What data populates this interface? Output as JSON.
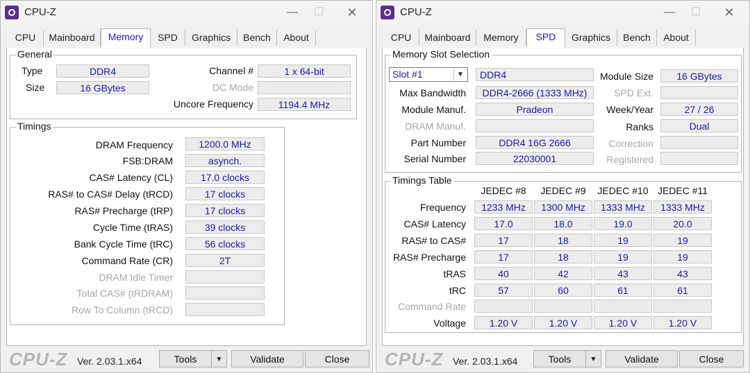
{
  "app": {
    "title": "CPU-Z"
  },
  "tabs": [
    "CPU",
    "Mainboard",
    "Memory",
    "SPD",
    "Graphics",
    "Bench",
    "About"
  ],
  "memory": {
    "general_label": "General",
    "type_label": "Type",
    "type": "DDR4",
    "size_label": "Size",
    "size": "16 GBytes",
    "channel_label": "Channel #",
    "channel": "1 x 64-bit",
    "dc_mode_label": "DC Mode",
    "dc_mode": "",
    "uncore_label": "Uncore Frequency",
    "uncore": "1194.4 MHz",
    "timings_label": "Timings",
    "timings": [
      {
        "label": "DRAM Frequency",
        "value": "1200.0 MHz"
      },
      {
        "label": "FSB:DRAM",
        "value": "asynch."
      },
      {
        "label": "CAS# Latency (CL)",
        "value": "17.0 clocks"
      },
      {
        "label": "RAS# to CAS# Delay (tRCD)",
        "value": "17 clocks"
      },
      {
        "label": "RAS# Precharge (tRP)",
        "value": "17 clocks"
      },
      {
        "label": "Cycle Time (tRAS)",
        "value": "39 clocks"
      },
      {
        "label": "Bank Cycle Time (tRC)",
        "value": "56 clocks"
      },
      {
        "label": "Command Rate (CR)",
        "value": "2T"
      },
      {
        "label": "DRAM Idle Timer",
        "value": ""
      },
      {
        "label": "Total CAS# (tRDRAM)",
        "value": ""
      },
      {
        "label": "Row To Column (tRCD)",
        "value": ""
      }
    ]
  },
  "spd": {
    "slot_section_label": "Memory Slot Selection",
    "slot": "Slot #1",
    "module_type": "DDR4",
    "max_bw_label": "Max Bandwidth",
    "max_bw": "DDR4-2666 (1333 MHz)",
    "manuf_label": "Module Manuf.",
    "manuf": "Pradeon",
    "dram_manuf_label": "DRAM Manuf.",
    "dram_manuf": "",
    "part_label": "Part Number",
    "part": "DDR4 16G 2666",
    "serial_label": "Serial Number",
    "serial": "22030001",
    "module_size_label": "Module Size",
    "module_size": "16 GBytes",
    "spd_ext_label": "SPD Ext.",
    "spd_ext": "",
    "week_year_label": "Week/Year",
    "week_year": "27 / 26",
    "ranks_label": "Ranks",
    "ranks": "Dual",
    "correction_label": "Correction",
    "correction": "",
    "registered_label": "Registered",
    "registered": "",
    "timings_table_label": "Timings Table",
    "columns": [
      "JEDEC #8",
      "JEDEC #9",
      "JEDEC #10",
      "JEDEC #11"
    ],
    "rows": [
      {
        "label": "Frequency",
        "values": [
          "1233 MHz",
          "1300 MHz",
          "1333 MHz",
          "1333 MHz"
        ]
      },
      {
        "label": "CAS# Latency",
        "values": [
          "17.0",
          "18.0",
          "19.0",
          "20.0"
        ]
      },
      {
        "label": "RAS# to CAS#",
        "values": [
          "17",
          "18",
          "19",
          "19"
        ]
      },
      {
        "label": "RAS# Precharge",
        "values": [
          "17",
          "18",
          "19",
          "19"
        ]
      },
      {
        "label": "tRAS",
        "values": [
          "40",
          "42",
          "43",
          "43"
        ]
      },
      {
        "label": "tRC",
        "values": [
          "57",
          "60",
          "61",
          "61"
        ]
      },
      {
        "label": "Command Rate",
        "values": [
          "",
          "",
          "",
          ""
        ]
      },
      {
        "label": "Voltage",
        "values": [
          "1.20 V",
          "1.20 V",
          "1.20 V",
          "1.20 V"
        ]
      }
    ]
  },
  "footer": {
    "logo": "CPU-Z",
    "version": "Ver. 2.03.1.x64",
    "tools": "Tools",
    "validate": "Validate",
    "close": "Close"
  },
  "icons": {
    "app": "cpu-z-icon",
    "minimize": "minimize-icon",
    "maximize": "maximize-icon",
    "close": "close-icon",
    "dropdown": "chevron-down-icon"
  }
}
